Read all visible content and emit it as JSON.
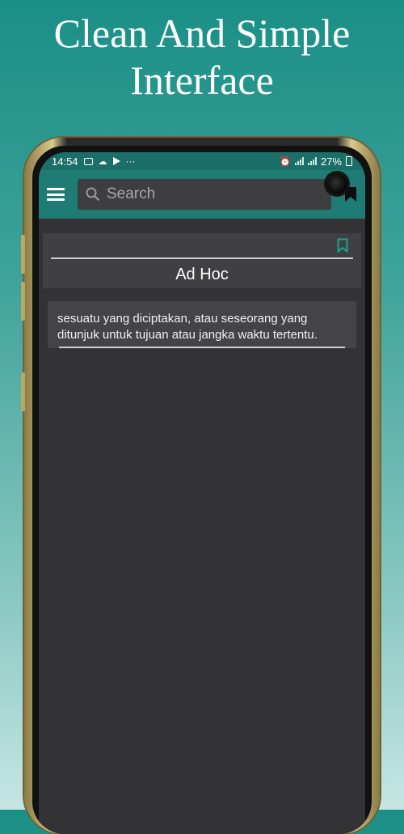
{
  "promo": {
    "line1": "Clean And Simple",
    "line2": "Interface"
  },
  "status_bar": {
    "time": "14:54",
    "ellipsis": "···",
    "battery": "27%"
  },
  "toolbar": {
    "search_placeholder": "Search"
  },
  "word_card": {
    "word": "Ad Hoc"
  },
  "definition": {
    "text": "sesuatu yang diciptakan, atau seseorang yang ditunjuk untuk tujuan atau jangka waktu tertentu."
  },
  "colors": {
    "toolbar": "#1f7c74",
    "bookmark_accent": "#1aa595",
    "screen_bg": "#333234"
  },
  "icons": [
    "menu-icon",
    "search-icon",
    "bookmark-icon",
    "bookmark-outline-icon"
  ]
}
